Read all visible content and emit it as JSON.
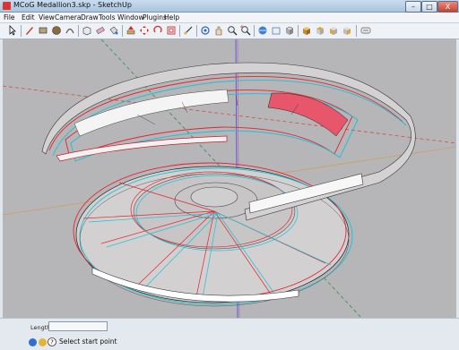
{
  "window": {
    "title": "MCoG Medallion3.skp - SketchUp",
    "minimize": "–",
    "maximize": "□",
    "close": "X"
  },
  "menu": [
    "File",
    "Edit",
    "View",
    "Camera",
    "Draw",
    "Tools",
    "Window",
    "Plugins",
    "Help"
  ],
  "toolbar": {
    "tools": [
      "select-tool",
      "line-tool",
      "rectangle-tool",
      "circle-tool",
      "arc-tool",
      "make-component-tool",
      "eraser-tool",
      "paint-bucket-tool",
      "push-pull-tool",
      "move-tool",
      "rotate-tool",
      "offset-tool",
      "tape-measure-tool",
      "orbit-tool",
      "pan-tool",
      "zoom-tool",
      "zoom-extents-tool",
      "get-models-tool",
      "share-model-tool",
      "components-tool",
      "section-plane-tool",
      "iso-view-tool",
      "top-view-tool",
      "front-view-tool",
      "right-view-tool",
      "back-view-tool",
      "left-view-tool",
      "xray-tool"
    ]
  },
  "viewport": {
    "background": "#b6b5b8",
    "model": "3D medallion (anaglyph red/cyan)"
  },
  "status": {
    "length_label": "Length",
    "length_value": "",
    "hint": "Select start point"
  },
  "colors": {
    "red": "#e8232f",
    "cyan": "#19c3d6",
    "axis_red": "#d94a3c",
    "axis_green": "#2f8f4a",
    "axis_blue": "#3a52d3"
  }
}
